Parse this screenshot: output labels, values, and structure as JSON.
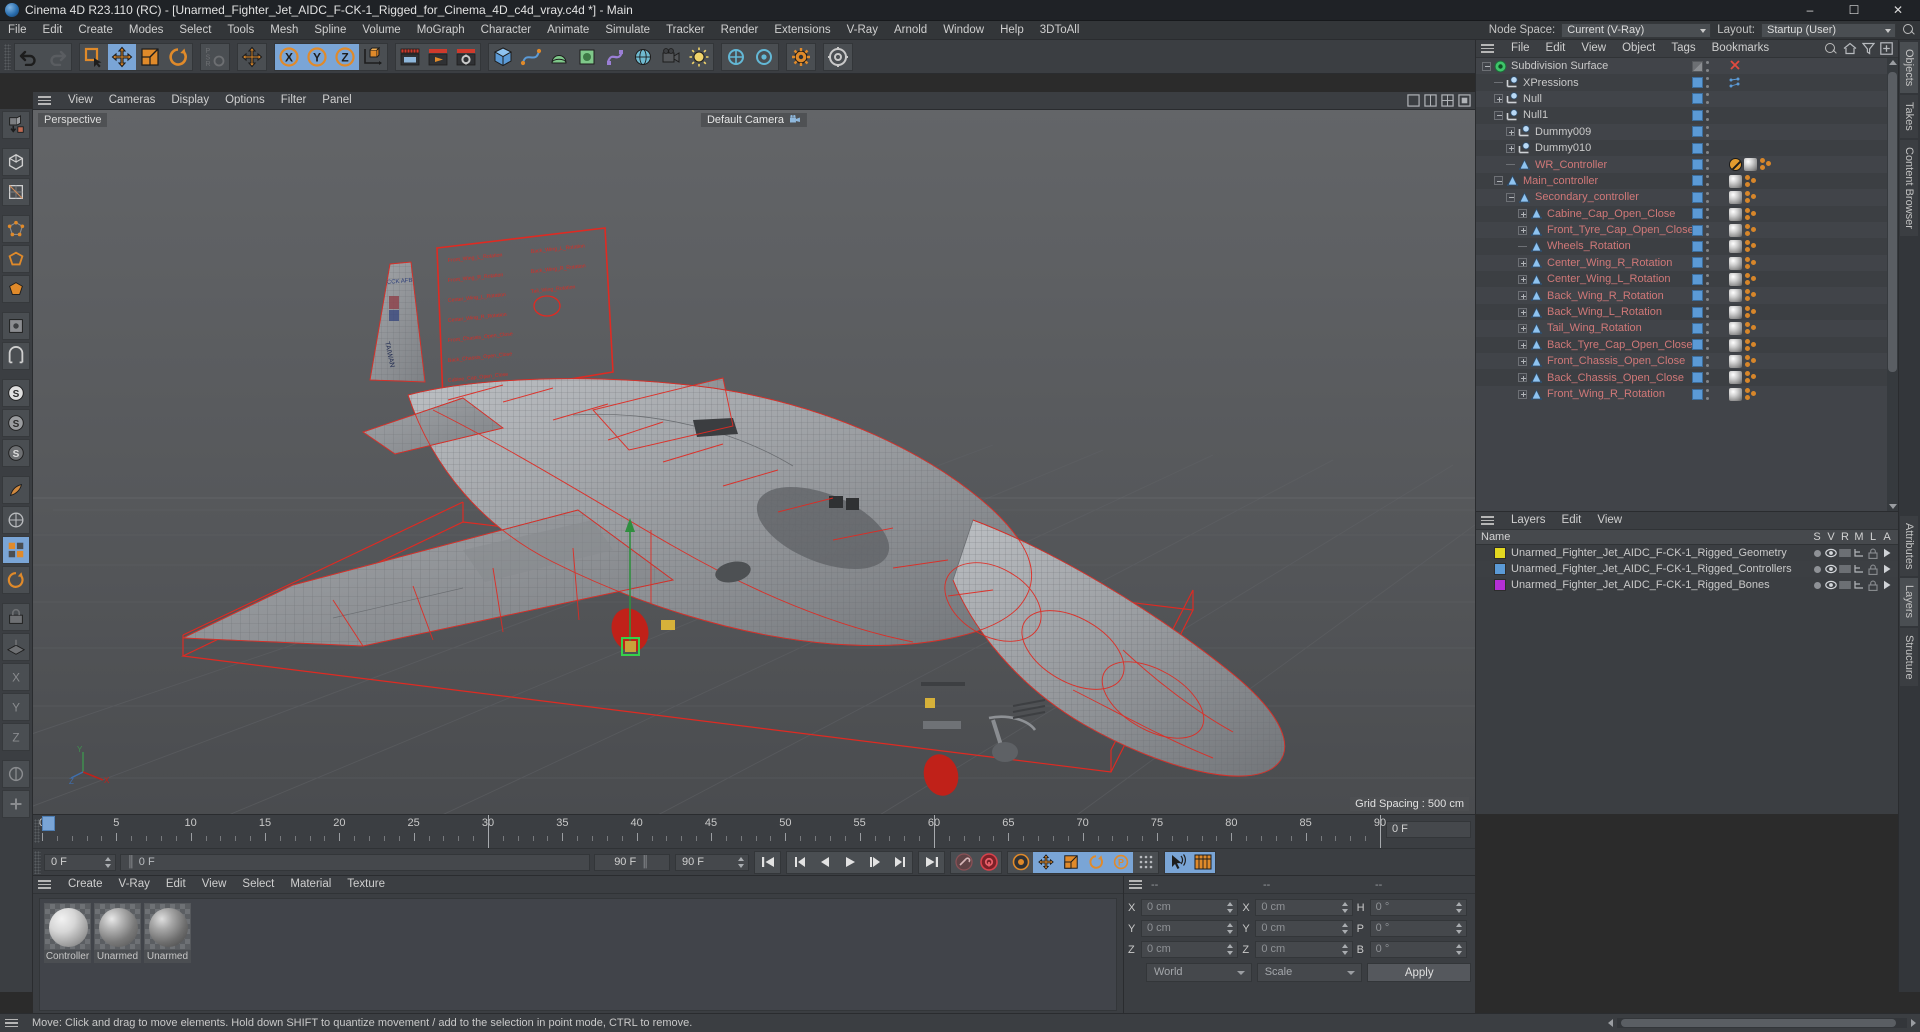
{
  "window": {
    "title": "Cinema 4D R23.110 (RC) - [Unarmed_Fighter_Jet_AIDC_F-CK-1_Rigged_for_Cinema_4D_c4d_vray.c4d *] - Main",
    "minimize": "–",
    "maximize": "☐",
    "close": "✕"
  },
  "menubar": {
    "items": [
      "File",
      "Edit",
      "Create",
      "Modes",
      "Select",
      "Tools",
      "Mesh",
      "Spline",
      "Volume",
      "MoGraph",
      "Character",
      "Animate",
      "Simulate",
      "Tracker",
      "Render",
      "Extensions",
      "V-Ray",
      "Arnold",
      "Window",
      "Help",
      "3DToAll"
    ],
    "node_space_label": "Node Space:",
    "node_space_value": "Current (V-Ray)",
    "layout_label": "Layout:",
    "layout_value": "Startup (User)"
  },
  "viewport": {
    "menu": [
      "View",
      "Cameras",
      "Display",
      "Options",
      "Filter",
      "Panel"
    ],
    "perspective_label": "Perspective",
    "camera_label": "Default Camera",
    "grid_spacing": "Grid Spacing : 500 cm",
    "axis_x": "X",
    "axis_y": "Y",
    "axis_z": "Z"
  },
  "object_manager": {
    "menu": [
      "File",
      "Edit",
      "View",
      "Object",
      "Tags",
      "Bookmarks"
    ],
    "rows": [
      {
        "label": "Subdivision Surface",
        "indent": 0,
        "icon": "subdivision-surface-icon",
        "expander": "minus",
        "box": "gray",
        "tags": [
          "close-x"
        ],
        "color": "neutral"
      },
      {
        "label": "XPressions",
        "indent": 1,
        "icon": "null-object-icon",
        "expander": "line",
        "box": "blue",
        "tags": [
          "xpresso"
        ],
        "color": "neutral"
      },
      {
        "label": "Null",
        "indent": 1,
        "icon": "null-object-icon",
        "expander": "plus",
        "box": "blue",
        "tags": [],
        "color": "neutral"
      },
      {
        "label": "Null1",
        "indent": 1,
        "icon": "null-object-icon",
        "expander": "minus",
        "box": "blue",
        "tags": [],
        "color": "neutral"
      },
      {
        "label": "Dummy009",
        "indent": 2,
        "icon": "null-object-icon",
        "expander": "plus",
        "box": "blue",
        "tags": [],
        "color": "neutral"
      },
      {
        "label": "Dummy010",
        "indent": 2,
        "icon": "null-object-icon",
        "expander": "plus",
        "box": "blue",
        "tags": [],
        "color": "neutral"
      },
      {
        "label": "WR_Controller",
        "indent": 2,
        "icon": "joint-icon",
        "expander": "line",
        "box": "blue",
        "tags": [
          "noshade",
          "sphere",
          "bones"
        ],
        "color": "red"
      },
      {
        "label": "Main_controller",
        "indent": 1,
        "icon": "joint-icon",
        "expander": "minus",
        "box": "blue",
        "tags": [
          "sphere",
          "bones"
        ],
        "color": "red"
      },
      {
        "label": "Secondary_controller",
        "indent": 2,
        "icon": "joint-icon",
        "expander": "minus",
        "box": "blue",
        "tags": [
          "sphere",
          "bones"
        ],
        "color": "red"
      },
      {
        "label": "Cabine_Cap_Open_Close",
        "indent": 3,
        "icon": "joint-icon",
        "expander": "plus",
        "box": "blue",
        "tags": [
          "sphere",
          "bones"
        ],
        "color": "red"
      },
      {
        "label": "Front_Tyre_Cap_Open_Close",
        "indent": 3,
        "icon": "joint-icon",
        "expander": "plus",
        "box": "blue",
        "tags": [
          "sphere",
          "bones"
        ],
        "color": "red"
      },
      {
        "label": "Wheels_Rotation",
        "indent": 3,
        "icon": "joint-icon",
        "expander": "line",
        "box": "blue",
        "tags": [
          "sphere",
          "bones"
        ],
        "color": "red"
      },
      {
        "label": "Center_Wing_R_Rotation",
        "indent": 3,
        "icon": "joint-icon",
        "expander": "plus",
        "box": "blue",
        "tags": [
          "sphere",
          "bones"
        ],
        "color": "red"
      },
      {
        "label": "Center_Wing_L_Rotation",
        "indent": 3,
        "icon": "joint-icon",
        "expander": "plus",
        "box": "blue",
        "tags": [
          "sphere",
          "bones"
        ],
        "color": "red"
      },
      {
        "label": "Back_Wing_R_Rotation",
        "indent": 3,
        "icon": "joint-icon",
        "expander": "plus",
        "box": "blue",
        "tags": [
          "sphere",
          "bones"
        ],
        "color": "red"
      },
      {
        "label": "Back_Wing_L_Rotation",
        "indent": 3,
        "icon": "joint-icon",
        "expander": "plus",
        "box": "blue",
        "tags": [
          "sphere",
          "bones"
        ],
        "color": "red"
      },
      {
        "label": "Tail_Wing_Rotation",
        "indent": 3,
        "icon": "joint-icon",
        "expander": "plus",
        "box": "blue",
        "tags": [
          "sphere",
          "bones"
        ],
        "color": "red"
      },
      {
        "label": "Back_Tyre_Cap_Open_Close",
        "indent": 3,
        "icon": "joint-icon",
        "expander": "plus",
        "box": "blue",
        "tags": [
          "sphere",
          "bones"
        ],
        "color": "red"
      },
      {
        "label": "Front_Chassis_Open_Close",
        "indent": 3,
        "icon": "joint-icon",
        "expander": "plus",
        "box": "blue",
        "tags": [
          "sphere",
          "bones"
        ],
        "color": "red"
      },
      {
        "label": "Back_Chassis_Open_Close",
        "indent": 3,
        "icon": "joint-icon",
        "expander": "plus",
        "box": "blue",
        "tags": [
          "sphere",
          "bones"
        ],
        "color": "red"
      },
      {
        "label": "Front_Wing_R_Rotation",
        "indent": 3,
        "icon": "joint-icon",
        "expander": "plus",
        "box": "blue",
        "tags": [
          "sphere",
          "bones"
        ],
        "color": "red"
      }
    ]
  },
  "layer_manager": {
    "menu": [
      "Layers",
      "Edit",
      "View"
    ],
    "header_name": "Name",
    "columns": [
      "S",
      "V",
      "R",
      "M",
      "L",
      "A"
    ],
    "rows": [
      {
        "color": "#e3d820",
        "label": "Unarmed_Fighter_Jet_AIDC_F-CK-1_Rigged_Geometry"
      },
      {
        "color": "#5b9ad6",
        "label": "Unarmed_Fighter_Jet_AIDC_F-CK-1_Rigged_Controllers"
      },
      {
        "color": "#b42fd6",
        "label": "Unarmed_Fighter_Jet_AIDC_F-CK-1_Rigged_Bones"
      }
    ]
  },
  "right_dock_tabs": [
    "Objects",
    "Takes",
    "Content Browser",
    "Attributes",
    "Layers",
    "Structure"
  ],
  "timeline": {
    "ticks": [
      0,
      5,
      10,
      15,
      20,
      25,
      30,
      35,
      40,
      45,
      50,
      55,
      60,
      65,
      70,
      75,
      80,
      85,
      90
    ],
    "min": 0,
    "max": 90,
    "current_frame_field": "0 F",
    "start_field": "0 F",
    "preview_start": "0 F",
    "end_field": "90 F",
    "preview_end": "90 F",
    "range_max_label": "90 F"
  },
  "material_manager": {
    "menu": [
      "Create",
      "V-Ray",
      "Edit",
      "View",
      "Select",
      "Material",
      "Texture"
    ],
    "materials": [
      {
        "name": "Controller",
        "kind": "plain-gray"
      },
      {
        "name": "Unarmed",
        "kind": "textured-1"
      },
      {
        "name": "Unarmed",
        "kind": "textured-2"
      }
    ]
  },
  "coordinates": {
    "header_left": "--",
    "header_mid": "--",
    "header_right": "--",
    "position": {
      "x_label": "X",
      "y_label": "Y",
      "z_label": "Z",
      "x": "0 cm",
      "y": "0 cm",
      "z": "0 cm"
    },
    "size": {
      "x_label": "X",
      "y_label": "Y",
      "z_label": "Z",
      "x": "0 cm",
      "y": "0 cm",
      "z": "0 cm"
    },
    "rotation": {
      "h_label": "H",
      "p_label": "P",
      "b_label": "B",
      "h": "0 °",
      "p": "0 °",
      "b": "0 °"
    },
    "coord_system": "World",
    "mode": "Scale",
    "apply_label": "Apply"
  },
  "status_bar": {
    "message": "Move: Click and drag to move elements. Hold down SHIFT to quantize movement / add to the selection in point mode, CTRL to remove."
  },
  "colors": {
    "accent_blue": "#7aa5d6",
    "orange": "#e08a2a",
    "wire_red": "#e02a22",
    "panel_bg": "#3b3e42",
    "list_bg": "#414449",
    "text": "#c9c9c9"
  }
}
